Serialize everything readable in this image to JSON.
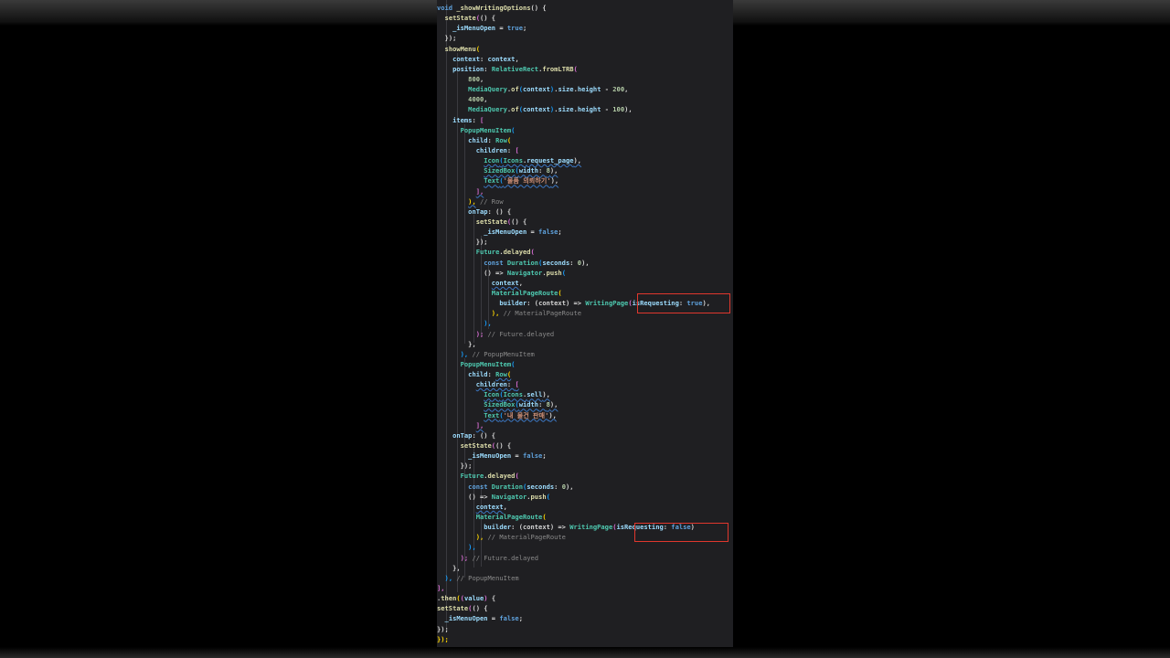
{
  "colors": {
    "background": "#000000",
    "editor_background": "#1f1f22",
    "highlight_box": "#e0372d",
    "keyword": "#5fa2dd",
    "class": "#4ec9b0",
    "string": "#ce9178"
  },
  "code_lines": [
    [
      [
        "void ",
        "kw"
      ],
      [
        "_showWritingOptions",
        "fn"
      ],
      [
        "() {",
        "p"
      ]
    ],
    [
      [
        "  ",
        "p"
      ],
      [
        "setState",
        "fn"
      ],
      [
        "(",
        "br2"
      ],
      [
        "() {",
        "p"
      ]
    ],
    [
      [
        "    ",
        "p"
      ],
      [
        "_isMenuOpen",
        "var"
      ],
      [
        " = ",
        "p"
      ],
      [
        "true",
        "kw"
      ],
      [
        ";",
        "p"
      ]
    ],
    [
      [
        "  ",
        "p"
      ],
      [
        "});",
        "p"
      ]
    ],
    [
      [
        "  ",
        "p"
      ],
      [
        "showMenu",
        "fn"
      ],
      [
        "(",
        "br1"
      ]
    ],
    [
      [
        "    ",
        "p"
      ],
      [
        "context",
        "var"
      ],
      [
        ": ",
        "p"
      ],
      [
        "context",
        "var"
      ],
      [
        ",",
        "p"
      ]
    ],
    [
      [
        "    ",
        "p"
      ],
      [
        "position",
        "var"
      ],
      [
        ": ",
        "p"
      ],
      [
        "RelativeRect",
        "cls"
      ],
      [
        ".",
        "p"
      ],
      [
        "fromLTRB",
        "fn"
      ],
      [
        "(",
        "br2"
      ]
    ],
    [
      [
        "        ",
        "p"
      ],
      [
        "800",
        "num"
      ],
      [
        ",",
        "p"
      ]
    ],
    [
      [
        "        ",
        "p"
      ],
      [
        "MediaQuery",
        "cls"
      ],
      [
        ".",
        "p"
      ],
      [
        "of",
        "fn"
      ],
      [
        "(",
        "br3"
      ],
      [
        "context",
        "var"
      ],
      [
        ")",
        "br3"
      ],
      [
        ".",
        "p"
      ],
      [
        "size",
        "var"
      ],
      [
        ".",
        "p"
      ],
      [
        "height",
        "var"
      ],
      [
        " - ",
        "p"
      ],
      [
        "200",
        "num"
      ],
      [
        ",",
        "p"
      ]
    ],
    [
      [
        "        ",
        "p"
      ],
      [
        "4000",
        "num"
      ],
      [
        ",",
        "p"
      ]
    ],
    [
      [
        "        ",
        "p"
      ],
      [
        "MediaQuery",
        "cls"
      ],
      [
        ".",
        "p"
      ],
      [
        "of",
        "fn"
      ],
      [
        "(",
        "br3"
      ],
      [
        "context",
        "var"
      ],
      [
        ")",
        "br3"
      ],
      [
        ".",
        "p"
      ],
      [
        "size",
        "var"
      ],
      [
        ".",
        "p"
      ],
      [
        "height",
        "var"
      ],
      [
        " - ",
        "p"
      ],
      [
        "100",
        "num"
      ],
      [
        "),",
        "p"
      ]
    ],
    [
      [
        "    ",
        "p"
      ],
      [
        "items",
        "var"
      ],
      [
        ": ",
        "p"
      ],
      [
        "[",
        "br2"
      ]
    ],
    [
      [
        "      ",
        "p"
      ],
      [
        "PopupMenuItem",
        "cls"
      ],
      [
        "(",
        "br3"
      ]
    ],
    [
      [
        "        ",
        "p"
      ],
      [
        "child",
        "var"
      ],
      [
        ": ",
        "p"
      ],
      [
        "Row",
        "cls"
      ],
      [
        "(",
        "br1"
      ]
    ],
    [
      [
        "          ",
        "p"
      ],
      [
        "children",
        "var"
      ],
      [
        ": ",
        "p"
      ],
      [
        "[",
        "br2"
      ]
    ],
    [
      [
        "            ",
        "p"
      ],
      [
        "Icon",
        "cls",
        "sq"
      ],
      [
        "(",
        "br3",
        "sq"
      ],
      [
        "Icons",
        "cls",
        "sq"
      ],
      [
        ".",
        "p",
        "sq"
      ],
      [
        "request_page",
        "var",
        "sq"
      ],
      [
        "),",
        "p",
        "sq"
      ]
    ],
    [
      [
        "            ",
        "p"
      ],
      [
        "SizedBox",
        "cls",
        "sq"
      ],
      [
        "(",
        "br3",
        "sq"
      ],
      [
        "width",
        "var",
        "sq"
      ],
      [
        ": ",
        "p",
        "sq"
      ],
      [
        "8",
        "num",
        "sq"
      ],
      [
        "),",
        "p",
        "sq"
      ]
    ],
    [
      [
        "            ",
        "p"
      ],
      [
        "Text",
        "cls",
        "sq"
      ],
      [
        "(",
        "br3",
        "sq"
      ],
      [
        "'물품 의뢰하기'",
        "str",
        "sq"
      ],
      [
        "),",
        "p",
        "sq"
      ]
    ],
    [
      [
        "          ",
        "p"
      ],
      [
        "],",
        "br2",
        "sq"
      ]
    ],
    [
      [
        "        ",
        "p"
      ],
      [
        "),",
        "br1",
        "sq"
      ],
      [
        " // Row",
        "cm"
      ]
    ],
    [
      [
        "        ",
        "p"
      ],
      [
        "onTap",
        "var"
      ],
      [
        ": ",
        "p"
      ],
      [
        "() {",
        "p"
      ]
    ],
    [
      [
        "          ",
        "p"
      ],
      [
        "setState",
        "fn"
      ],
      [
        "(",
        "br2"
      ],
      [
        "() {",
        "p"
      ]
    ],
    [
      [
        "            ",
        "p"
      ],
      [
        "_isMenuOpen",
        "var"
      ],
      [
        " = ",
        "p"
      ],
      [
        "false",
        "kw"
      ],
      [
        ";",
        "p"
      ]
    ],
    [
      [
        "          ",
        "p"
      ],
      [
        "});",
        "p"
      ]
    ],
    [
      [
        "          ",
        "p"
      ],
      [
        "Future",
        "cls"
      ],
      [
        ".",
        "p"
      ],
      [
        "delayed",
        "fn"
      ],
      [
        "(",
        "br2"
      ]
    ],
    [
      [
        "            ",
        "p"
      ],
      [
        "const ",
        "kw"
      ],
      [
        "Duration",
        "cls"
      ],
      [
        "(",
        "br3"
      ],
      [
        "seconds",
        "var"
      ],
      [
        ": ",
        "p"
      ],
      [
        "0",
        "num"
      ],
      [
        "),",
        "p"
      ]
    ],
    [
      [
        "            ",
        "p"
      ],
      [
        "() => ",
        "p"
      ],
      [
        "Navigator",
        "cls"
      ],
      [
        ".",
        "p"
      ],
      [
        "push",
        "fn"
      ],
      [
        "(",
        "br3"
      ]
    ],
    [
      [
        "              ",
        "p"
      ],
      [
        "context",
        "var",
        "sq"
      ],
      [
        ",",
        "p"
      ]
    ],
    [
      [
        "              ",
        "p"
      ],
      [
        "MaterialPageRoute",
        "cls"
      ],
      [
        "(",
        "br1"
      ]
    ],
    [
      [
        "                ",
        "p"
      ],
      [
        "builder",
        "var"
      ],
      [
        ": ",
        "p"
      ],
      [
        "(context) => ",
        "p"
      ],
      [
        "WritingPage",
        "cls"
      ],
      [
        "(",
        "br2"
      ],
      [
        "isRequesting",
        "var"
      ],
      [
        ": ",
        "p"
      ],
      [
        "true",
        "kw"
      ],
      [
        "),",
        "p"
      ]
    ],
    [
      [
        "              ",
        "p"
      ],
      [
        "),",
        "br1"
      ],
      [
        " // MaterialPageRoute",
        "cm"
      ]
    ],
    [
      [
        "            ",
        "p"
      ],
      [
        "),",
        "br3"
      ]
    ],
    [
      [
        "          ",
        "p"
      ],
      [
        ");",
        "br2"
      ],
      [
        " // Future.delayed",
        "cm"
      ]
    ],
    [
      [
        "        ",
        "p"
      ],
      [
        "},",
        "p"
      ]
    ],
    [
      [
        "      ",
        "p"
      ],
      [
        "),",
        "br3"
      ],
      [
        " // PopupMenuItem",
        "cm"
      ]
    ],
    [
      [
        "      ",
        "p"
      ],
      [
        "PopupMenuItem",
        "cls"
      ],
      [
        "(",
        "br3"
      ]
    ],
    [
      [
        "        ",
        "p"
      ],
      [
        "child",
        "var"
      ],
      [
        ": ",
        "p"
      ],
      [
        "Row",
        "cls",
        "sq"
      ],
      [
        "(",
        "br1",
        "sq"
      ]
    ],
    [
      [
        "          ",
        "p"
      ],
      [
        "children",
        "var",
        "sq"
      ],
      [
        ": ",
        "p",
        "sq"
      ],
      [
        "[",
        "br2",
        "sq"
      ]
    ],
    [
      [
        "            ",
        "p"
      ],
      [
        "Icon",
        "cls",
        "sq"
      ],
      [
        "(",
        "br3",
        "sq"
      ],
      [
        "Icons",
        "cls",
        "sq"
      ],
      [
        ".",
        "p",
        "sq"
      ],
      [
        "sell",
        "var",
        "sq"
      ],
      [
        "),",
        "p",
        "sq"
      ]
    ],
    [
      [
        "            ",
        "p"
      ],
      [
        "SizedBox",
        "cls",
        "sq"
      ],
      [
        "(",
        "br3",
        "sq"
      ],
      [
        "width",
        "var",
        "sq"
      ],
      [
        ": ",
        "p",
        "sq"
      ],
      [
        "8",
        "num",
        "sq"
      ],
      [
        "),",
        "p",
        "sq"
      ]
    ],
    [
      [
        "            ",
        "p"
      ],
      [
        "Text",
        "cls",
        "sq"
      ],
      [
        "(",
        "br3",
        "sq"
      ],
      [
        "'내 물건 판매'",
        "str",
        "sq"
      ],
      [
        "),",
        "p",
        "sq"
      ]
    ],
    [
      [
        "          ",
        "p"
      ],
      [
        "],",
        "br2",
        "sq"
      ]
    ],
    [
      [
        "    ",
        "p"
      ],
      [
        "onTap",
        "var"
      ],
      [
        ": ",
        "p"
      ],
      [
        "() {",
        "p"
      ]
    ],
    [
      [
        "      ",
        "p"
      ],
      [
        "setState",
        "fn"
      ],
      [
        "(",
        "br2"
      ],
      [
        "() {",
        "p"
      ]
    ],
    [
      [
        "        ",
        "p"
      ],
      [
        "_isMenuOpen",
        "var"
      ],
      [
        " = ",
        "p"
      ],
      [
        "false",
        "kw"
      ],
      [
        ";",
        "p"
      ]
    ],
    [
      [
        "      ",
        "p"
      ],
      [
        "});",
        "p"
      ]
    ],
    [
      [
        "      ",
        "p"
      ],
      [
        "Future",
        "cls"
      ],
      [
        ".",
        "p"
      ],
      [
        "delayed",
        "fn"
      ],
      [
        "(",
        "br2"
      ]
    ],
    [
      [
        "        ",
        "p"
      ],
      [
        "const ",
        "kw"
      ],
      [
        "Duration",
        "cls"
      ],
      [
        "(",
        "br3"
      ],
      [
        "seconds",
        "var"
      ],
      [
        ": ",
        "p"
      ],
      [
        "0",
        "num"
      ],
      [
        "),",
        "p"
      ]
    ],
    [
      [
        "        ",
        "p"
      ],
      [
        "() => ",
        "p"
      ],
      [
        "Navigator",
        "cls"
      ],
      [
        ".",
        "p"
      ],
      [
        "push",
        "fn"
      ],
      [
        "(",
        "br3"
      ]
    ],
    [
      [
        "          ",
        "p"
      ],
      [
        "context",
        "var",
        "sq"
      ],
      [
        ",",
        "p"
      ]
    ],
    [
      [
        "          ",
        "p"
      ],
      [
        "MaterialPageRoute",
        "cls"
      ],
      [
        "(",
        "br1"
      ]
    ],
    [
      [
        "            ",
        "p"
      ],
      [
        "builder",
        "var"
      ],
      [
        ": ",
        "p"
      ],
      [
        "(context) => ",
        "p"
      ],
      [
        "WritingPage",
        "cls"
      ],
      [
        "(",
        "br2"
      ],
      [
        "isRequesting",
        "var"
      ],
      [
        ": ",
        "p"
      ],
      [
        "false",
        "kw"
      ],
      [
        ")",
        "p"
      ]
    ],
    [
      [
        "          ",
        "p"
      ],
      [
        "),",
        "br1"
      ],
      [
        " // MaterialPageRoute",
        "cm"
      ]
    ],
    [
      [
        "        ",
        "p"
      ],
      [
        "),",
        "br3"
      ]
    ],
    [
      [
        "      ",
        "p"
      ],
      [
        ");",
        "br2"
      ],
      [
        " // Future.delayed",
        "cm"
      ]
    ],
    [
      [
        "    ",
        "p"
      ],
      [
        "},",
        "p"
      ]
    ],
    [
      [
        "  ",
        "p"
      ],
      [
        "),",
        "br3"
      ],
      [
        " // PopupMenuItem",
        "cm"
      ]
    ],
    [
      [
        "],",
        "br2"
      ]
    ],
    [
      [
        ".",
        "p"
      ],
      [
        "then",
        "fn"
      ],
      [
        "(",
        "br1"
      ],
      [
        "(",
        "br2"
      ],
      [
        "value",
        "var"
      ],
      [
        ")",
        "br2"
      ],
      [
        " {",
        "p"
      ]
    ],
    [
      [
        "setState",
        "fn"
      ],
      [
        "(",
        "br2"
      ],
      [
        "() {",
        "p"
      ]
    ],
    [
      [
        "  ",
        "p"
      ],
      [
        "_isMenuOpen",
        "var"
      ],
      [
        " = ",
        "p"
      ],
      [
        "false",
        "kw"
      ],
      [
        ";",
        "p"
      ]
    ],
    [
      [
        "});",
        "p"
      ]
    ],
    [
      [
        "});",
        "br1"
      ]
    ]
  ]
}
